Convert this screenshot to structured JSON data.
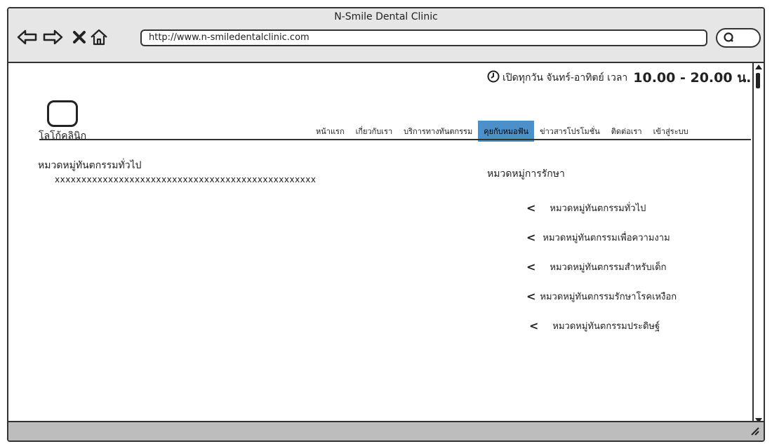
{
  "window": {
    "title": "N-Smile Dental Clinic"
  },
  "toolbar": {
    "url": "http://www.n-smiledentalclinic.com",
    "icons": [
      "back-arrow-icon",
      "forward-arrow-icon",
      "close-icon",
      "home-icon",
      "search-icon"
    ]
  },
  "header": {
    "hours_text": "เปิดทุกวัน จันทร์-อาทิตย์  เวลา",
    "hours_time": "10.00 - 20.00 น.",
    "logo_label": "โลโก้คลินิก"
  },
  "nav": {
    "items": [
      {
        "label": "หน้าแรก"
      },
      {
        "label": "เกี่ยวกับเรา"
      },
      {
        "label": "บริการทางทันตกรรม"
      },
      {
        "label": "คุยกับหมอฟัน"
      },
      {
        "label": "ข่าวสารโปรโมชั่น"
      },
      {
        "label": "ติดต่อเรา"
      },
      {
        "label": "เข้าสู่ระบบ"
      }
    ],
    "active_index": 3,
    "active_color": "#4d8fc9"
  },
  "main": {
    "section_title": "หมวดหมู่ทันตกรรมทั่วไป",
    "content_placeholder": "xxxxxxxxxxxxxxxxxxxxxxxxxxxxxxxxxxxxxxxxxxxxxxxxx"
  },
  "sidebar": {
    "title": "หมวดหมู่การรักษา",
    "items": [
      {
        "label": "หมวดหมู่ทันตกรรมทั่วไป"
      },
      {
        "label": "หมวดหมู่ทันตกรรมเพื่อความงาม"
      },
      {
        "label": "หมวดหมู่ทันตกรรมสำหรับเด็ก"
      },
      {
        "label": "หมวดหมู่ทันตกรรมรักษาโรคเหงือก"
      },
      {
        "label": "หมวดหมู่ทันตกรรมประดิษฐ์"
      }
    ]
  }
}
